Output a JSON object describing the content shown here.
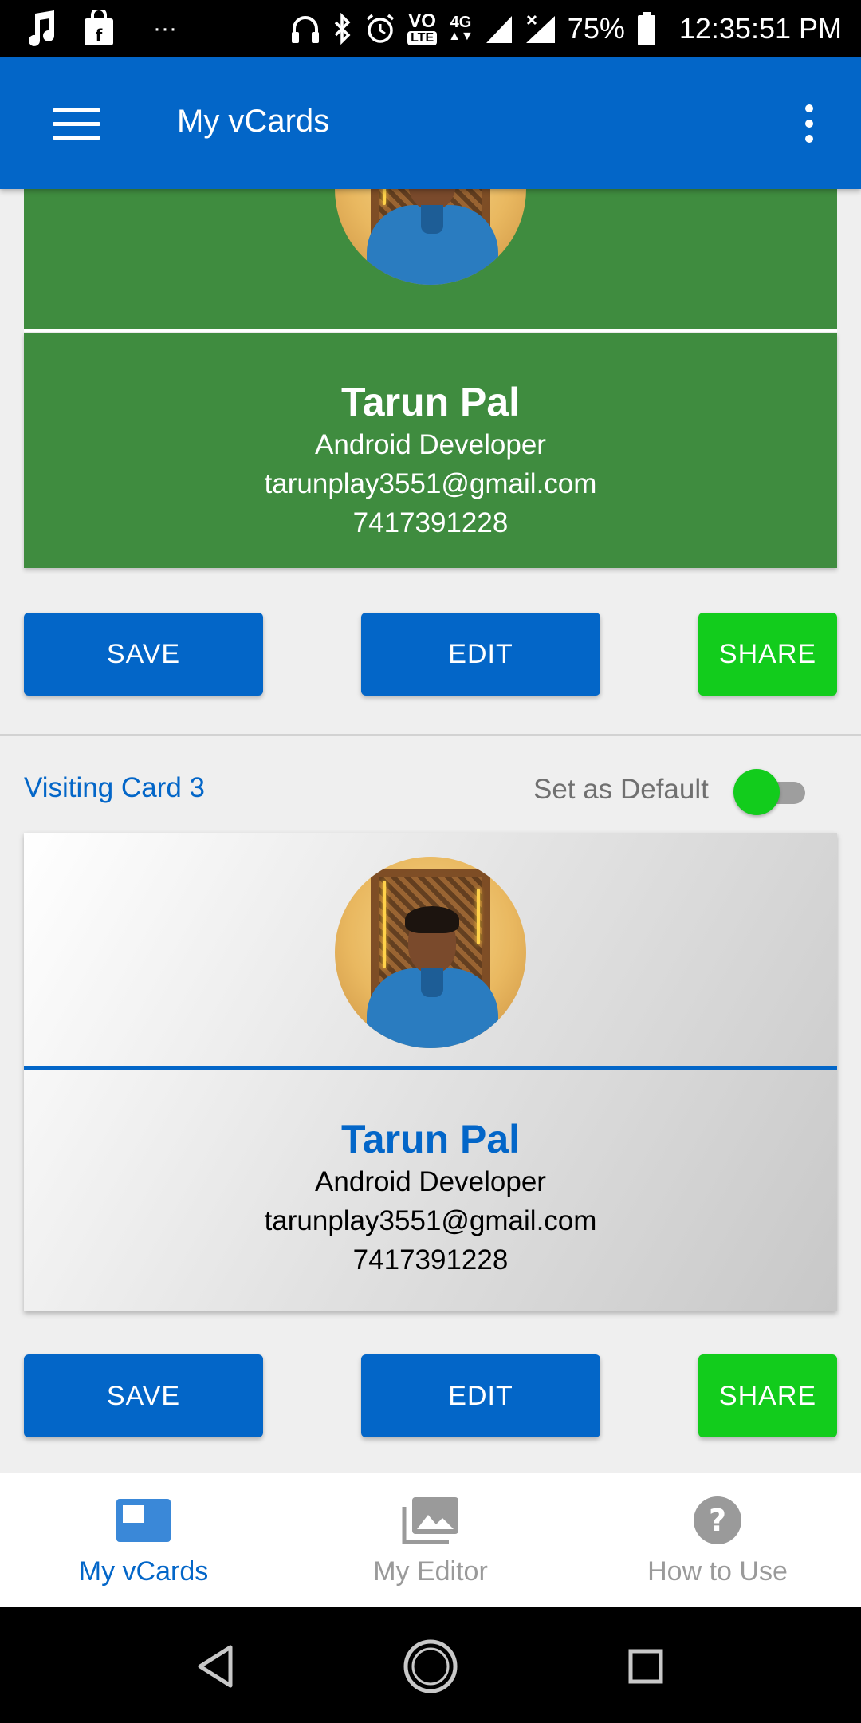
{
  "status_bar": {
    "dots": "···",
    "volte_top": "VO",
    "volte_bottom": "LTE",
    "network": "4G",
    "battery": "75%",
    "time": "12:35:51 PM"
  },
  "app_bar": {
    "title": "My vCards"
  },
  "cards": [
    {
      "name": "Tarun Pal",
      "role": "Android Developer",
      "email": "tarunplay3551@gmail.com",
      "phone": "7417391228",
      "theme_color": "#3f8c3f",
      "buttons": {
        "save": "SAVE",
        "edit": "EDIT",
        "share": "SHARE"
      }
    },
    {
      "label": "Visiting Card 3",
      "default_label": "Set as Default",
      "default_on": true,
      "name": "Tarun Pal",
      "role": "Android Developer",
      "email": "tarunplay3551@gmail.com",
      "phone": "7417391228",
      "theme_color": "#0366c8",
      "buttons": {
        "save": "SAVE",
        "edit": "EDIT",
        "share": "SHARE"
      }
    }
  ],
  "bottom_nav": {
    "items": [
      {
        "label": "My vCards",
        "icon": "vcard-icon",
        "active": true
      },
      {
        "label": "My Editor",
        "icon": "photo-library-icon",
        "active": false
      },
      {
        "label": "How to Use",
        "icon": "help-icon",
        "active": false
      }
    ]
  },
  "colors": {
    "primary": "#0366c8",
    "share_green": "#12cc1c",
    "card_green": "#3f8c3f",
    "inactive_gray": "#9a9a9a"
  }
}
